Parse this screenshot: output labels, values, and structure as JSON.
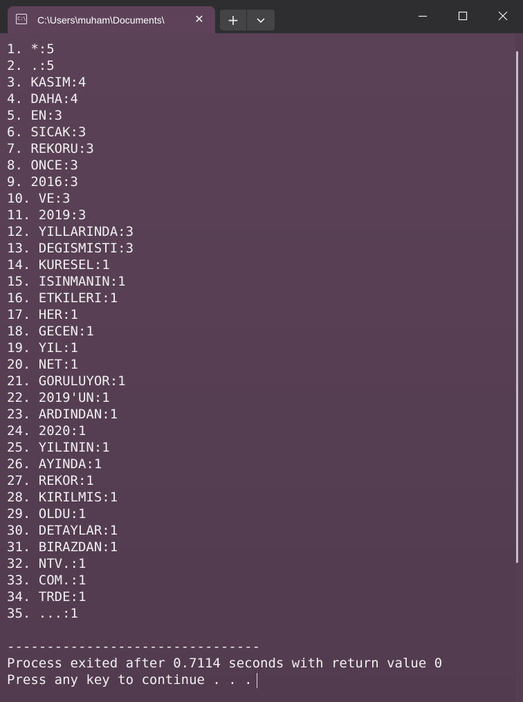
{
  "window": {
    "tab_title": "C:\\Users\\muham\\Documents\\",
    "tab_icon": "console-icon",
    "tab_close_glyph": "✕",
    "new_tab_glyph": "+",
    "colors": {
      "titlebar": "#2e2e30",
      "tab_active": "#5e4259",
      "terminal_background": "#563e52",
      "text": "#f0f0f0"
    }
  },
  "terminal": {
    "lines": [
      "1. *:5",
      "2. .:5",
      "3. KASIM:4",
      "4. DAHA:4",
      "5. EN:3",
      "6. SICAK:3",
      "7. REKORU:3",
      "8. ONCE:3",
      "9. 2016:3",
      "10. VE:3",
      "11. 2019:3",
      "12. YILLARINDA:3",
      "13. DEGISMISTI:3",
      "14. KURESEL:1",
      "15. ISINMANIN:1",
      "16. ETKILERI:1",
      "17. HER:1",
      "18. GECEN:1",
      "19. YIL:1",
      "20. NET:1",
      "21. GORULUYOR:1",
      "22. 2019'UN:1",
      "23. ARDINDAN:1",
      "24. 2020:1",
      "25. YILININ:1",
      "26. AYINDA:1",
      "27. REKOR:1",
      "28. KIRILMIS:1",
      "29. OLDU:1",
      "30. DETAYLAR:1",
      "31. BIRAZDAN:1",
      "32. NTV.:1",
      "33. COM.:1",
      "34. TRDE:1",
      "35. ...:1"
    ],
    "separator": "--------------------------------",
    "exit_message": "Process exited after 0.7114 seconds with return value 0",
    "prompt": "Press any key to continue . . ."
  }
}
